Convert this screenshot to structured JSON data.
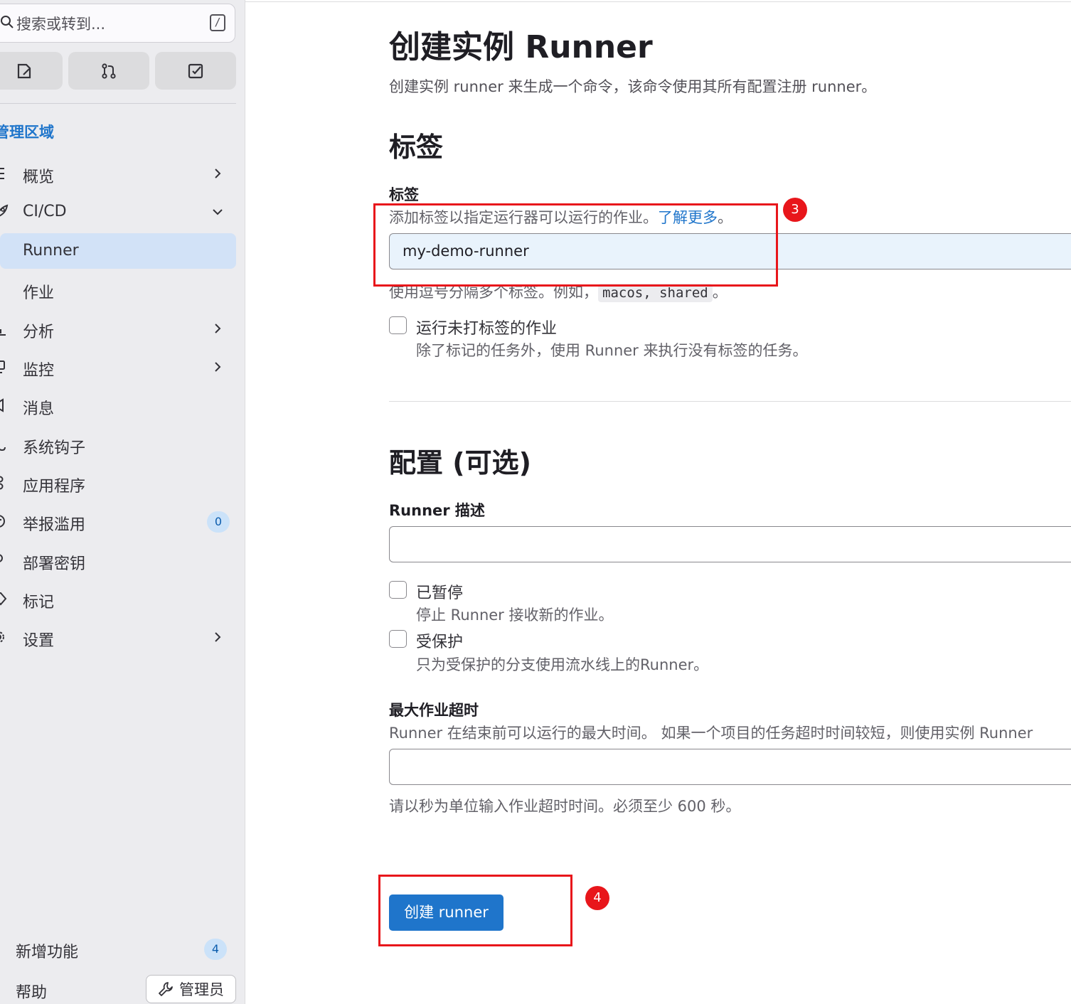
{
  "sidebar": {
    "search_placeholder": "搜索或转到...",
    "search_shortcut": "/",
    "quick_actions": [
      "issues-icon",
      "merge-request-icon",
      "todo-icon"
    ],
    "section_title": "管理区域",
    "items": [
      {
        "label": "概览",
        "icon": "list-icon",
        "chevron": "right"
      },
      {
        "label": "CI/CD",
        "icon": "rocket-icon",
        "chevron": "down"
      },
      {
        "label": "Runner",
        "icon": "",
        "active": true
      },
      {
        "label": "作业",
        "icon": ""
      },
      {
        "label": "分析",
        "icon": "chart-icon",
        "chevron": "right"
      },
      {
        "label": "监控",
        "icon": "monitor-icon",
        "chevron": "right"
      },
      {
        "label": "消息",
        "icon": "megaphone-icon"
      },
      {
        "label": "系统钩子",
        "icon": "hook-icon"
      },
      {
        "label": "应用程序",
        "icon": "apps-icon"
      },
      {
        "label": "举报滥用",
        "icon": "abuse-icon",
        "badge": "0"
      },
      {
        "label": "部署密钥",
        "icon": "key-icon"
      },
      {
        "label": "标记",
        "icon": "label-icon"
      },
      {
        "label": "设置",
        "icon": "settings-icon",
        "chevron": "right"
      }
    ],
    "footer": {
      "whats_new": "新增功能",
      "whats_new_badge": "4",
      "help": "帮助",
      "admin_button": "管理员"
    }
  },
  "main": {
    "title": "创建实例 Runner",
    "description": "创建实例 runner 来生成一个命令，该命令使用其所有配置注册 runner。",
    "tags_section": {
      "heading": "标签",
      "label": "标签",
      "help_prefix": "添加标签以指定运行器可以运行的作业。",
      "help_link": "了解更多",
      "help_suffix": "。",
      "value": "my-demo-runner",
      "hint_prefix": "使用逗号分隔多个标签。例如，",
      "hint_code": "macos, shared",
      "hint_suffix": "。",
      "run_untagged_label": "运行未打标签的作业",
      "run_untagged_help": "除了标记的任务外，使用 Runner 来执行没有标签的任务。"
    },
    "config_section": {
      "heading": "配置 (可选)",
      "description_label": "Runner 描述",
      "description_value": "",
      "paused_label": "已暂停",
      "paused_help": "停止 Runner 接收新的作业。",
      "protected_label": "受保护",
      "protected_help": "只为受保护的分支使用流水线上的Runner。",
      "timeout_label": "最大作业超时",
      "timeout_help": "Runner 在结束前可以运行的最大时间。 如果一个项目的任务超时时间较短，则使用实例 Runner",
      "timeout_value": "",
      "timeout_hint": "请以秒为单位输入作业超时时间。必须至少 600 秒。"
    },
    "submit_button": "创建 runner"
  },
  "annotations": {
    "marker_3": "3",
    "marker_4": "4"
  },
  "colors": {
    "accent": "#1f75cb",
    "annotation": "#e8161b",
    "active_nav": "#d2e2f7"
  }
}
